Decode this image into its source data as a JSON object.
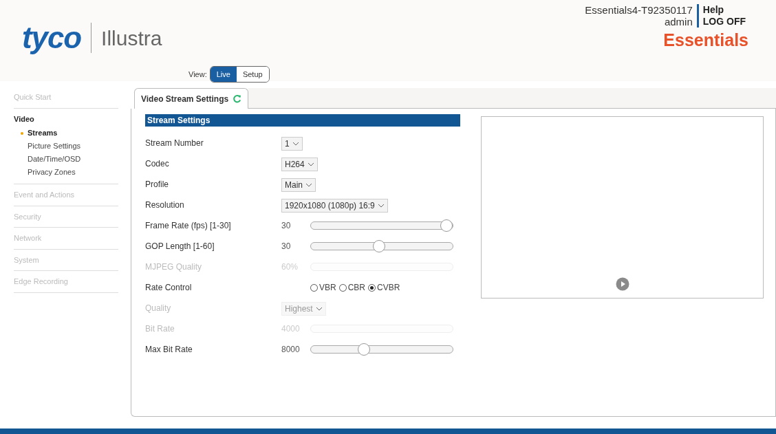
{
  "header": {
    "logo": "tyco",
    "product": "Illustra",
    "device": "Essentials4-T92350117",
    "user": "admin",
    "links": [
      "Help",
      "LOG OFF"
    ],
    "edition": "Essentials"
  },
  "view": {
    "label": "View:",
    "options": [
      {
        "label": "Live",
        "selected": true
      },
      {
        "label": "Setup",
        "selected": false
      }
    ]
  },
  "sidebar": {
    "items": [
      {
        "label": "Quick Start",
        "disabled": true
      },
      {
        "label": "Video",
        "disabled": false,
        "children": [
          {
            "label": "Streams",
            "selected": true
          },
          {
            "label": "Picture Settings",
            "selected": false
          },
          {
            "label": "Date/Time/OSD",
            "selected": false
          },
          {
            "label": "Privacy Zones",
            "selected": false
          }
        ]
      },
      {
        "label": "Event and Actions",
        "disabled": true
      },
      {
        "label": "Security",
        "disabled": true
      },
      {
        "label": "Network",
        "disabled": true
      },
      {
        "label": "System",
        "disabled": true
      },
      {
        "label": "Edge Recording",
        "disabled": true
      }
    ]
  },
  "tab": {
    "label": "Video Stream Settings"
  },
  "section": {
    "title": "Stream Settings"
  },
  "rows": [
    {
      "kind": "select",
      "label": "Stream Number",
      "value": "1",
      "disabled": false
    },
    {
      "kind": "select",
      "label": "Codec",
      "value": "H264",
      "disabled": false
    },
    {
      "kind": "select",
      "label": "Profile",
      "value": "Main",
      "disabled": false
    },
    {
      "kind": "select",
      "label": "Resolution",
      "value": "1920x1080 (1080p) 16:9",
      "disabled": false
    },
    {
      "kind": "slider",
      "label": "Frame Rate (fps) [1-30]",
      "reading": "30",
      "level": 1,
      "disabled": false
    },
    {
      "kind": "slider",
      "label": "GOP Length [1-60]",
      "reading": "30",
      "level": 0.48,
      "disabled": false
    },
    {
      "kind": "slider",
      "label": "MJPEG Quality",
      "reading": "60%",
      "disabled": true
    },
    {
      "kind": "radio",
      "label": "Rate Control",
      "options": [
        {
          "label": "VBR",
          "selected": false
        },
        {
          "label": "CBR",
          "selected": false
        },
        {
          "label": "CVBR",
          "selected": true
        }
      ]
    },
    {
      "kind": "select",
      "label": "Quality",
      "value": "Highest",
      "disabled": true
    },
    {
      "kind": "slider",
      "label": "Bit Rate",
      "reading": "4000",
      "disabled": true
    },
    {
      "kind": "slider",
      "label": "Max Bit Rate",
      "reading": "8000",
      "level": 0.36,
      "disabled": false
    }
  ]
}
